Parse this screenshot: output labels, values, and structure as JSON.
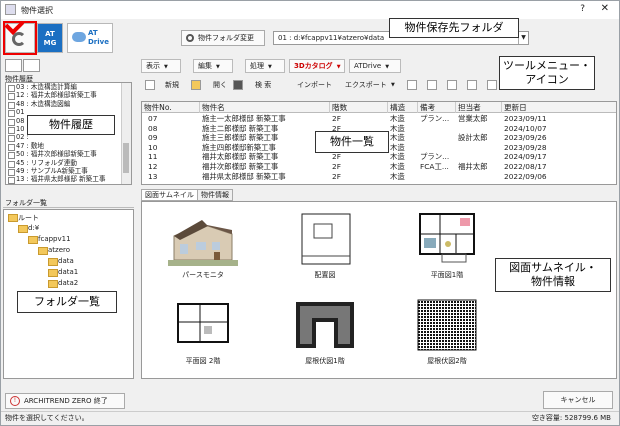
{
  "window": {
    "title": "物件選択",
    "help": "?",
    "close": "✕"
  },
  "top_buttons": {
    "archi_label": "AT\nMG",
    "at_drive_label": "AT\nDrive"
  },
  "folder_change": {
    "label": "物件フォルダ変更",
    "path": "01 : d:¥fcappv11¥atzero¥data"
  },
  "callouts": {
    "folder_save": "物件保存先フォルダ",
    "tool_menu": "ツールメニュー・\nアイコン",
    "history": "物件履歴",
    "list": "物件一覧",
    "thumbnail": "図面サムネイル・\n物件情報",
    "folders": "フォルダ一覧"
  },
  "history": {
    "label": "物件履歴",
    "items": [
      "03 : 木造構造計算編",
      "12 : 福井太郎様邸新築工事",
      "48 : 木造構造図編",
      "01",
      "08",
      "10",
      "02 :",
      "47 : 敷地",
      "50 : 福井次郎様邸新築工事",
      "45 : リフォルダ連動",
      "49 : サンプルA新築工事",
      "13 : 福井県太郎様邸 新築工事"
    ]
  },
  "folders": {
    "label": "フォルダ一覧",
    "items": [
      "ルート",
      "d:¥",
      "fcappv11",
      "atzero",
      "data",
      "data1",
      "data2"
    ]
  },
  "toolbar1": {
    "items": [
      "表示",
      "編集",
      "処理",
      "3Dカタログ",
      "ATDrive"
    ]
  },
  "toolbar2": {
    "new": "新規",
    "open": "開く",
    "search": "検 索",
    "import": "インポート",
    "export": "エクスポート"
  },
  "table": {
    "headers": [
      "物件No.",
      "物件名",
      "階数",
      "構造",
      "備考",
      "担当者",
      "更新日"
    ],
    "rows": [
      [
        "07",
        "施主一太郎様邸 新築工事",
        "2F",
        "木造",
        "プラン...",
        "営業太郎",
        "2023/09/11"
      ],
      [
        "08",
        "施主二郎様邸 新築工事",
        "2F",
        "木造",
        "",
        "",
        "2024/10/07"
      ],
      [
        "09",
        "施主三郎様邸 新築工事",
        "2F",
        "木造",
        "",
        "設計太郎",
        "2023/09/26"
      ],
      [
        "10",
        "施主四郎様邸新築工事",
        "2F",
        "木造",
        "",
        "",
        "2023/09/28"
      ],
      [
        "11",
        "福井太郎様邸 新築工事",
        "2F",
        "木造",
        "プラン...",
        "",
        "2024/09/17"
      ],
      [
        "12",
        "福井次郎様邸 新築工事",
        "2F",
        "木造",
        "FCA工...",
        "福井太郎",
        "2022/08/17"
      ],
      [
        "13",
        "福井県太郎様邸 新築工事",
        "2F",
        "木造",
        "",
        "",
        "2022/09/06"
      ]
    ]
  },
  "tabs": {
    "thumbnail": "図面サムネイル",
    "info": "物件情報"
  },
  "thumbnails": [
    "パースモニタ",
    "配置図",
    "平面図1階",
    "平面図 2階",
    "屋根伏図1階",
    "屋根伏図2階"
  ],
  "footer": {
    "exit": "ARCHITREND ZERO 終了",
    "cancel": "キャンセル",
    "status": "物件を選択してください。",
    "free_space": "空き容量:     528799.6 MB"
  },
  "colors": {
    "accent": "#1b6fc2",
    "callout_border": "#e00000"
  }
}
